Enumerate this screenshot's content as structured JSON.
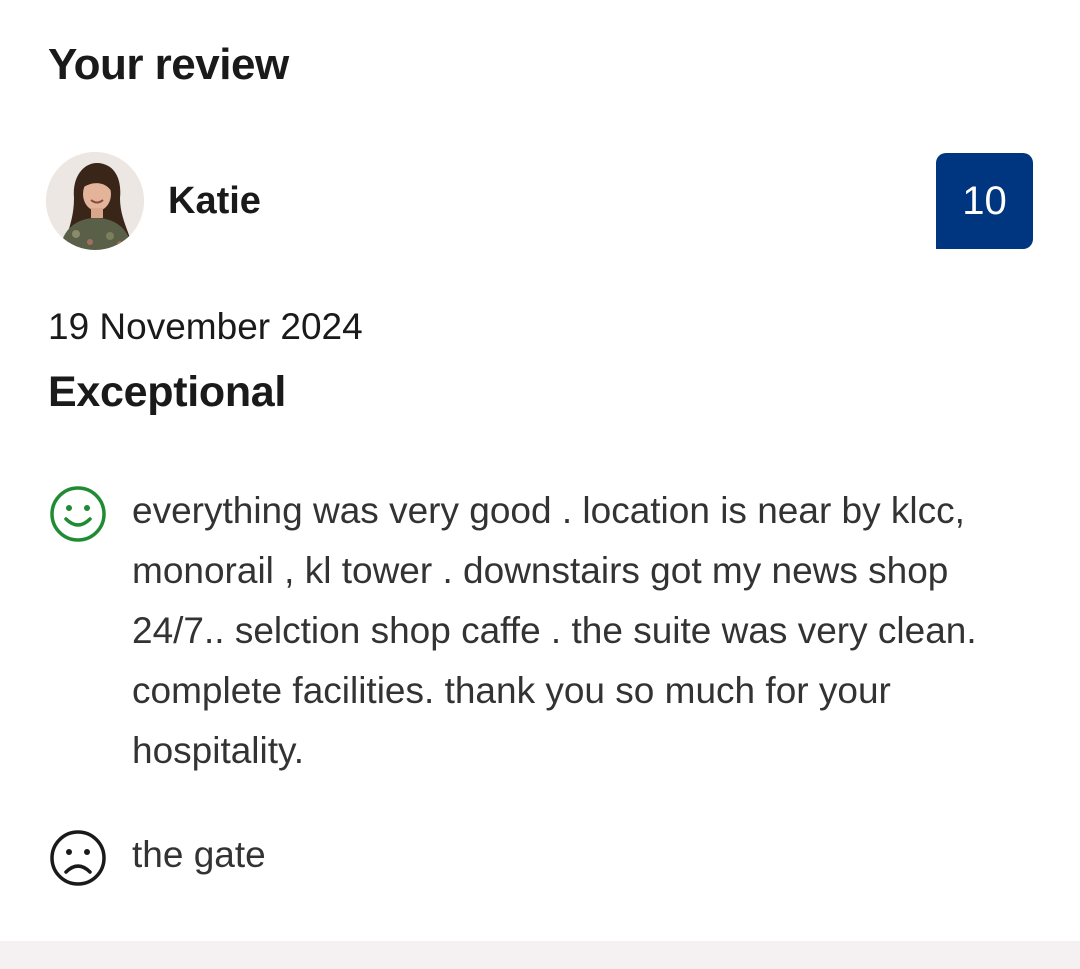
{
  "section": {
    "heading": "Your review"
  },
  "reviewer": {
    "name": "Katie",
    "avatar_icon": "user-photo-avatar"
  },
  "score": {
    "value": "10",
    "badge_color": "#003580"
  },
  "review": {
    "date": "19 November 2024",
    "title": "Exceptional",
    "positive": {
      "icon": "smiley-face-icon",
      "icon_color": "#1f8c33",
      "text": "everything was very good . location is near by klcc, monorail , kl tower . downstairs got my news shop 24/7.. selction shop caffe . the suite was very clean. complete facilities. thank you so much for your hospitality."
    },
    "negative": {
      "icon": "sad-face-icon",
      "icon_color": "#1a1a1a",
      "text": "the gate"
    }
  }
}
